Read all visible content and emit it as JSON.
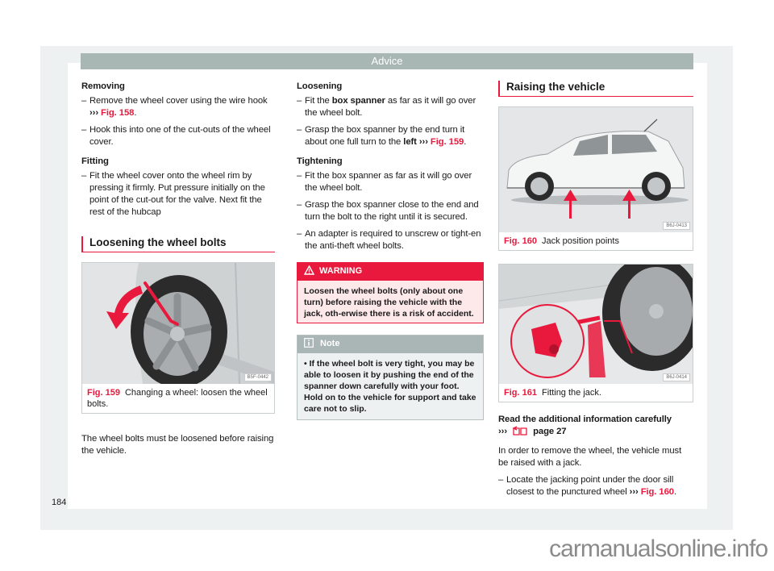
{
  "header": {
    "title": "Advice"
  },
  "col1": {
    "removing_heading": "Removing",
    "removing_items": [
      {
        "text": "Remove the wheel cover using the wire hook ",
        "arrow": "›››",
        "ref": "Fig. 158",
        "end": "."
      },
      {
        "text": "Hook this into one of the cut-outs of the wheel cover."
      }
    ],
    "fitting_heading": "Fitting",
    "fitting_items": [
      {
        "text": "Fit the wheel cover onto the wheel rim by pressing it firmly. Put pressure initially on the point of the cut-out for the valve. Next fit the rest of the hubcap"
      }
    ],
    "section_title": "Loosening the wheel bolts",
    "figure": {
      "code": "B5F-0442",
      "number": "Fig. 159",
      "caption": "Changing a wheel: loosen the wheel bolts."
    },
    "body": "The wheel bolts must be loosened before raising the vehicle."
  },
  "col2": {
    "loosening_heading": "Loosening",
    "loosening_items": [
      {
        "pre": "Fit the ",
        "bold": "box spanner",
        "post": " as far as it will go over the wheel bolt."
      },
      {
        "pre": "Grasp the box spanner by the end turn it about one full turn to the ",
        "bold": "left",
        "arrow": " ›››",
        "ref": " Fig. 159",
        "end": "."
      }
    ],
    "tightening_heading": "Tightening",
    "tightening_items": [
      "Fit the box spanner as far as it will go over the wheel bolt.",
      "Grasp the box spanner close to the end and turn the bolt to the right until it is secured.",
      "An adapter is required to unscrew or tight-en the anti-theft wheel bolts."
    ],
    "warning": {
      "icon": "warning-triangle-icon",
      "label": "WARNING",
      "text": "Loosen the wheel bolts (only about one turn) before raising the vehicle with the jack, oth-erwise there is a risk of accident."
    },
    "note": {
      "icon": "info-icon",
      "label": "Note",
      "text": "If the wheel bolt is very tight, you may be able to loosen it by pushing the end of the spanner down carefully with your foot. Hold on to the vehicle for support and take care not to slip."
    }
  },
  "col3": {
    "section_title": "Raising the vehicle",
    "figure1": {
      "code": "B6J-0413",
      "number": "Fig. 160",
      "caption": "Jack position points"
    },
    "figure2": {
      "code": "B6J-0414",
      "number": "Fig. 161",
      "caption": "Fitting the jack."
    },
    "read_heading": "Read the additional information carefully",
    "read_ref_arrow": "›››",
    "read_ref_page": "page 27",
    "body": "In order to remove the wheel, the vehicle must be raised with a jack.",
    "items": [
      {
        "text": "Locate the jacking point under the door sill closest to the punctured wheel ",
        "arrow": "›››",
        "ref": " Fig. 160",
        "end": "."
      }
    ]
  },
  "page_number": "184",
  "watermark": "carmanualsonline.info",
  "colors": {
    "accent": "#e8193c",
    "header": "#a8b6b4",
    "note_header": "#aab6b5"
  }
}
